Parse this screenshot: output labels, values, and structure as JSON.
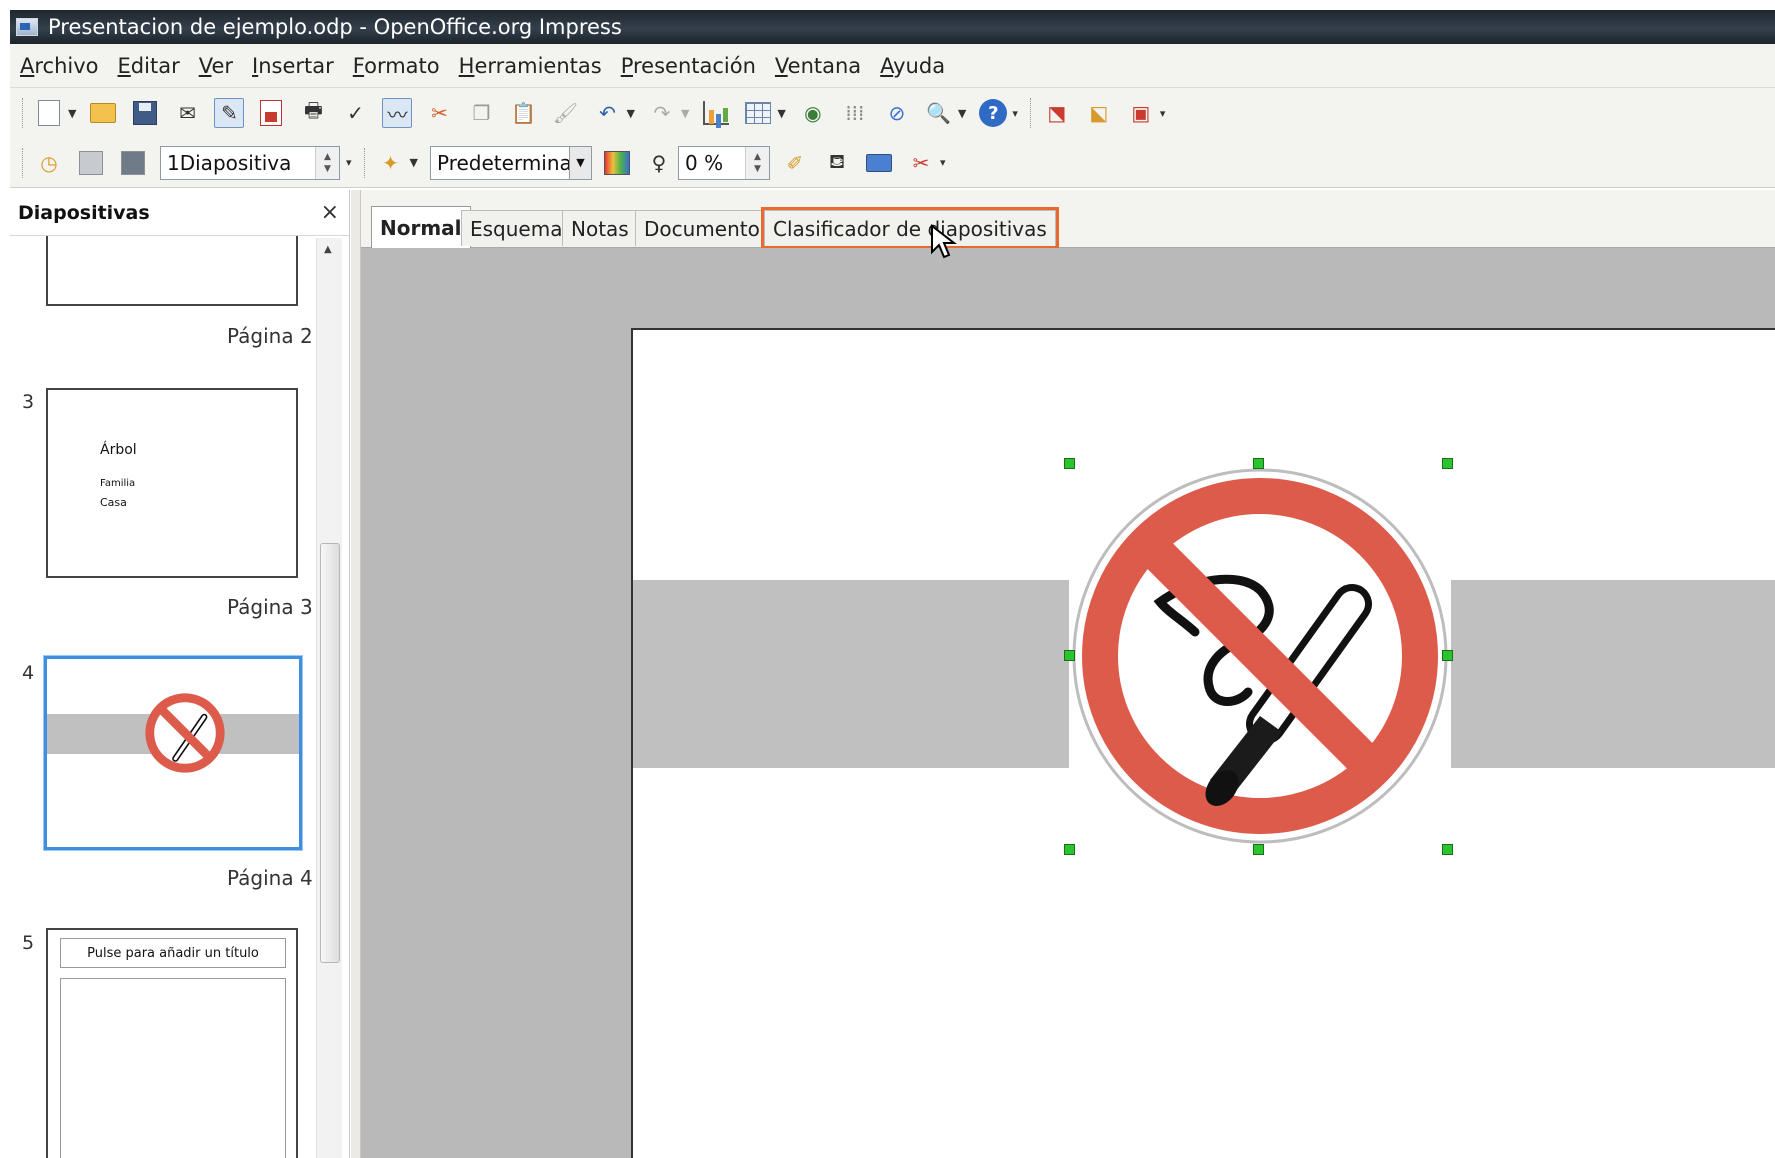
{
  "window": {
    "title": "Presentacion de ejemplo.odp - OpenOffice.org Impress"
  },
  "menu": [
    "Archivo",
    "Editar",
    "Ver",
    "Insertar",
    "Formato",
    "Herramientas",
    "Presentación",
    "Ventana",
    "Ayuda"
  ],
  "toolbar2": {
    "slide_selector": "1Diapositiva",
    "style_selector": "Predeterminad",
    "transparency": "0 %"
  },
  "sidebar": {
    "title": "Diapositivas",
    "close_label": "×",
    "slides": [
      {
        "number": "",
        "page_label": "Página 2"
      },
      {
        "number": "3",
        "page_label": "Página 3",
        "lines": [
          "Árbol",
          "Familia",
          "Casa"
        ]
      },
      {
        "number": "4",
        "page_label": "Página 4"
      },
      {
        "number": "5",
        "page_label": "",
        "title_placeholder": "Pulse para añadir un título"
      }
    ]
  },
  "tabs": [
    {
      "label": "Normal",
      "active": true
    },
    {
      "label": "Esquema",
      "active": false
    },
    {
      "label": "Notas",
      "active": false
    },
    {
      "label": "Documento",
      "active": false
    },
    {
      "label": "Clasificador de diapositivas",
      "active": false,
      "highlighted": true
    }
  ],
  "colors": {
    "sign_red": "#dd5b4b",
    "band_gray": "#c0c0c0",
    "workspace_gray": "#b9b9b9",
    "selection_handle": "#29c42e",
    "highlight_outline": "#e86a2f",
    "selected_thumb_border": "#3f8fe0"
  },
  "icons": {
    "slide_image": "no-smoking-sign-icon"
  }
}
